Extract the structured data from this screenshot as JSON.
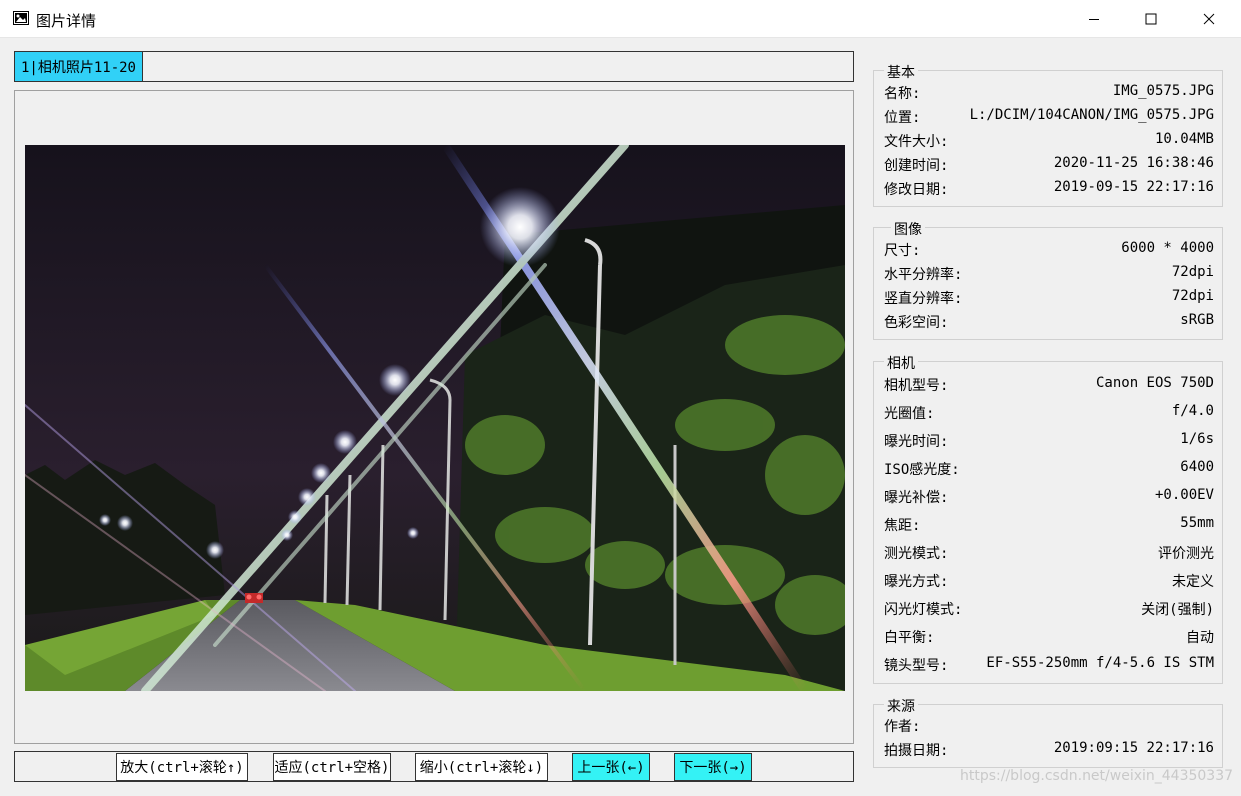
{
  "window": {
    "title": "图片详情",
    "controls": {
      "minimize": "minimize-icon",
      "maximize": "maximize-icon",
      "close": "close-icon"
    }
  },
  "tabs": [
    {
      "label": "1|相机照片11-20",
      "active": true
    }
  ],
  "toolbar": {
    "zoom_in": "放大(ctrl+滚轮↑)",
    "fit": "适应(ctrl+空格)",
    "zoom_out": "缩小(ctrl+滚轮↓)",
    "prev": "上一张(←)",
    "next": "下一张(→)"
  },
  "info": {
    "basic": {
      "title": "基本",
      "rows": [
        {
          "key": "名称:",
          "value": "IMG_0575.JPG"
        },
        {
          "key": "位置:",
          "value": "L:/DCIM/104CANON/IMG_0575.JPG"
        },
        {
          "key": "文件大小:",
          "value": "10.04MB"
        },
        {
          "key": "创建时间:",
          "value": "2020-11-25 16:38:46"
        },
        {
          "key": "修改日期:",
          "value": "2019-09-15 22:17:16"
        }
      ]
    },
    "image": {
      "title": "图像",
      "rows": [
        {
          "key": "尺寸:",
          "value": "6000 * 4000"
        },
        {
          "key": "水平分辨率:",
          "value": "72dpi"
        },
        {
          "key": "竖直分辨率:",
          "value": "72dpi"
        },
        {
          "key": "色彩空间:",
          "value": "sRGB"
        }
      ]
    },
    "camera": {
      "title": "相机",
      "rows": [
        {
          "key": "相机型号:",
          "value": "Canon EOS 750D"
        },
        {
          "key": "光圈值:",
          "value": "f/4.0"
        },
        {
          "key": "曝光时间:",
          "value": "1/6s"
        },
        {
          "key": "ISO感光度:",
          "value": "6400"
        },
        {
          "key": "曝光补偿:",
          "value": "+0.00EV"
        },
        {
          "key": "焦距:",
          "value": "55mm"
        },
        {
          "key": "测光模式:",
          "value": "评价测光"
        },
        {
          "key": "曝光方式:",
          "value": "未定义"
        },
        {
          "key": "闪光灯模式:",
          "value": "关闭(强制)"
        },
        {
          "key": "白平衡:",
          "value": "自动"
        },
        {
          "key": "镜头型号:",
          "value": "EF-S55-250mm f/4-5.6 IS STM"
        }
      ]
    },
    "source": {
      "title": "来源",
      "rows": [
        {
          "key": "作者:",
          "value": ""
        },
        {
          "key": "拍摄日期:",
          "value": "2019:09:15 22:17:16"
        }
      ]
    }
  },
  "watermark": "https://blog.csdn.net/weixin_44350337",
  "colors": {
    "tab_active": "#31d1f7",
    "nav_button": "#34f2f5"
  }
}
